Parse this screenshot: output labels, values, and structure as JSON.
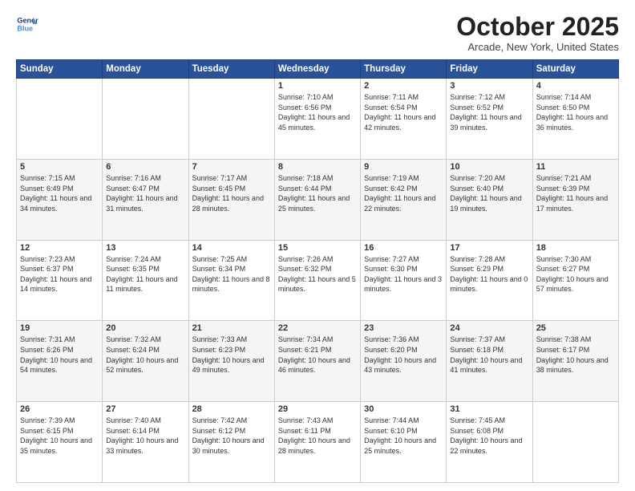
{
  "logo": {
    "line1": "General",
    "line2": "Blue"
  },
  "header": {
    "title": "October 2025",
    "subtitle": "Arcade, New York, United States"
  },
  "days_of_week": [
    "Sunday",
    "Monday",
    "Tuesday",
    "Wednesday",
    "Thursday",
    "Friday",
    "Saturday"
  ],
  "weeks": [
    [
      {
        "day": "",
        "info": ""
      },
      {
        "day": "",
        "info": ""
      },
      {
        "day": "",
        "info": ""
      },
      {
        "day": "1",
        "info": "Sunrise: 7:10 AM\nSunset: 6:56 PM\nDaylight: 11 hours and 45 minutes."
      },
      {
        "day": "2",
        "info": "Sunrise: 7:11 AM\nSunset: 6:54 PM\nDaylight: 11 hours and 42 minutes."
      },
      {
        "day": "3",
        "info": "Sunrise: 7:12 AM\nSunset: 6:52 PM\nDaylight: 11 hours and 39 minutes."
      },
      {
        "day": "4",
        "info": "Sunrise: 7:14 AM\nSunset: 6:50 PM\nDaylight: 11 hours and 36 minutes."
      }
    ],
    [
      {
        "day": "5",
        "info": "Sunrise: 7:15 AM\nSunset: 6:49 PM\nDaylight: 11 hours and 34 minutes."
      },
      {
        "day": "6",
        "info": "Sunrise: 7:16 AM\nSunset: 6:47 PM\nDaylight: 11 hours and 31 minutes."
      },
      {
        "day": "7",
        "info": "Sunrise: 7:17 AM\nSunset: 6:45 PM\nDaylight: 11 hours and 28 minutes."
      },
      {
        "day": "8",
        "info": "Sunrise: 7:18 AM\nSunset: 6:44 PM\nDaylight: 11 hours and 25 minutes."
      },
      {
        "day": "9",
        "info": "Sunrise: 7:19 AM\nSunset: 6:42 PM\nDaylight: 11 hours and 22 minutes."
      },
      {
        "day": "10",
        "info": "Sunrise: 7:20 AM\nSunset: 6:40 PM\nDaylight: 11 hours and 19 minutes."
      },
      {
        "day": "11",
        "info": "Sunrise: 7:21 AM\nSunset: 6:39 PM\nDaylight: 11 hours and 17 minutes."
      }
    ],
    [
      {
        "day": "12",
        "info": "Sunrise: 7:23 AM\nSunset: 6:37 PM\nDaylight: 11 hours and 14 minutes."
      },
      {
        "day": "13",
        "info": "Sunrise: 7:24 AM\nSunset: 6:35 PM\nDaylight: 11 hours and 11 minutes."
      },
      {
        "day": "14",
        "info": "Sunrise: 7:25 AM\nSunset: 6:34 PM\nDaylight: 11 hours and 8 minutes."
      },
      {
        "day": "15",
        "info": "Sunrise: 7:26 AM\nSunset: 6:32 PM\nDaylight: 11 hours and 5 minutes."
      },
      {
        "day": "16",
        "info": "Sunrise: 7:27 AM\nSunset: 6:30 PM\nDaylight: 11 hours and 3 minutes."
      },
      {
        "day": "17",
        "info": "Sunrise: 7:28 AM\nSunset: 6:29 PM\nDaylight: 11 hours and 0 minutes."
      },
      {
        "day": "18",
        "info": "Sunrise: 7:30 AM\nSunset: 6:27 PM\nDaylight: 10 hours and 57 minutes."
      }
    ],
    [
      {
        "day": "19",
        "info": "Sunrise: 7:31 AM\nSunset: 6:26 PM\nDaylight: 10 hours and 54 minutes."
      },
      {
        "day": "20",
        "info": "Sunrise: 7:32 AM\nSunset: 6:24 PM\nDaylight: 10 hours and 52 minutes."
      },
      {
        "day": "21",
        "info": "Sunrise: 7:33 AM\nSunset: 6:23 PM\nDaylight: 10 hours and 49 minutes."
      },
      {
        "day": "22",
        "info": "Sunrise: 7:34 AM\nSunset: 6:21 PM\nDaylight: 10 hours and 46 minutes."
      },
      {
        "day": "23",
        "info": "Sunrise: 7:36 AM\nSunset: 6:20 PM\nDaylight: 10 hours and 43 minutes."
      },
      {
        "day": "24",
        "info": "Sunrise: 7:37 AM\nSunset: 6:18 PM\nDaylight: 10 hours and 41 minutes."
      },
      {
        "day": "25",
        "info": "Sunrise: 7:38 AM\nSunset: 6:17 PM\nDaylight: 10 hours and 38 minutes."
      }
    ],
    [
      {
        "day": "26",
        "info": "Sunrise: 7:39 AM\nSunset: 6:15 PM\nDaylight: 10 hours and 35 minutes."
      },
      {
        "day": "27",
        "info": "Sunrise: 7:40 AM\nSunset: 6:14 PM\nDaylight: 10 hours and 33 minutes."
      },
      {
        "day": "28",
        "info": "Sunrise: 7:42 AM\nSunset: 6:12 PM\nDaylight: 10 hours and 30 minutes."
      },
      {
        "day": "29",
        "info": "Sunrise: 7:43 AM\nSunset: 6:11 PM\nDaylight: 10 hours and 28 minutes."
      },
      {
        "day": "30",
        "info": "Sunrise: 7:44 AM\nSunset: 6:10 PM\nDaylight: 10 hours and 25 minutes."
      },
      {
        "day": "31",
        "info": "Sunrise: 7:45 AM\nSunset: 6:08 PM\nDaylight: 10 hours and 22 minutes."
      },
      {
        "day": "",
        "info": ""
      }
    ]
  ]
}
